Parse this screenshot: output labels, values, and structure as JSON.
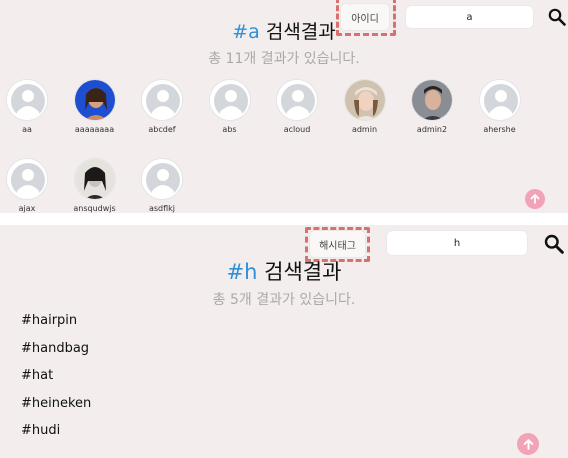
{
  "panel_id": {
    "search_type_label": "아이디",
    "search_value": "a",
    "title_tag": "#a",
    "title_rest": "검색결과",
    "subtitle": "총 11개 결과가 있습니다.",
    "users": [
      {
        "name": "aa",
        "photo": "default"
      },
      {
        "name": "aaaaaaaa",
        "photo": "blue"
      },
      {
        "name": "abcdef",
        "photo": "default"
      },
      {
        "name": "abs",
        "photo": "default"
      },
      {
        "name": "acloud",
        "photo": "default"
      },
      {
        "name": "admin",
        "photo": "beige"
      },
      {
        "name": "admin2",
        "photo": "grey"
      },
      {
        "name": "ahershe",
        "photo": "default"
      },
      {
        "name": "ajax",
        "photo": "default"
      },
      {
        "name": "ansqudwjs",
        "photo": "mono"
      },
      {
        "name": "asdflkj",
        "photo": "default"
      }
    ],
    "up_icon": "arrow-up-circle-icon"
  },
  "panel_hashtag": {
    "search_type_label": "해시태그",
    "search_value": "h",
    "title_tag": "#h",
    "title_rest": "검색결과",
    "subtitle": "총 5개 결과가 있습니다.",
    "hashtags": [
      "#hairpin",
      "#handbag",
      "#hat",
      "#heineken",
      "#hudi"
    ],
    "up_icon": "arrow-up-circle-icon"
  },
  "colors": {
    "panel_bg": "#f3eded",
    "accent": "#2f8fd8",
    "highlight_dash": "#d97070",
    "up_button": "#f2a3b8"
  }
}
